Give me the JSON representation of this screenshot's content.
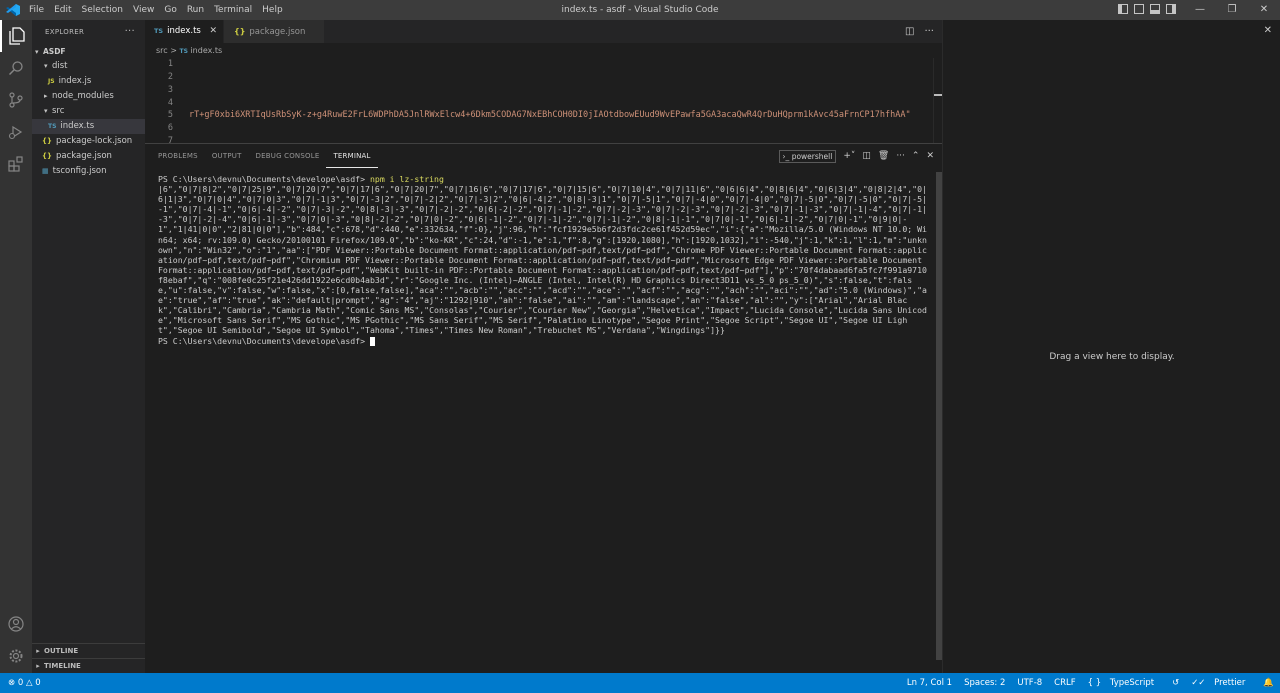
{
  "app": {
    "window_title": "index.ts - asdf - Visual Studio Code",
    "menu": [
      "File",
      "Edit",
      "Selection",
      "View",
      "Go",
      "Run",
      "Terminal",
      "Help"
    ]
  },
  "sidebar": {
    "header": "EXPLORER",
    "more": "···",
    "root": "ASDF",
    "tree": [
      {
        "label": "dist",
        "type": "folder-open"
      },
      {
        "label": "index.js",
        "type": "js"
      },
      {
        "label": "node_modules",
        "type": "folder-closed"
      },
      {
        "label": "src",
        "type": "folder-open"
      },
      {
        "label": "index.ts",
        "type": "ts"
      },
      {
        "label": "package-lock.json",
        "type": "json"
      },
      {
        "label": "package.json",
        "type": "json"
      },
      {
        "label": "tsconfig.json",
        "type": "tsconfig"
      }
    ],
    "outline": "OUTLINE",
    "timeline": "TIMELINE"
  },
  "editor": {
    "tabs": [
      {
        "label": "index.ts",
        "icon": "TS",
        "active": true
      },
      {
        "label": "package.json",
        "icon": "{}",
        "active": false
      }
    ],
    "breadcrumb": {
      "folder": "src",
      "sep": ">",
      "file_icon": "TS",
      "file": "index.ts"
    },
    "line_numbers": [
      "1",
      "2",
      "3",
      "4",
      "5",
      "6",
      "7"
    ],
    "line5": "rT+gF0xbi6XRTIqUsRbSyK-z+g4RuwE2FrL6WDPhDA5JnlRWxElcw4+6Dkm5CODAG7NxEBhCOH0DI0jIAOtdbowEUud9WvEPawfa5GA3acaQwR4QrDuHQprm1kAvc45aFrnCP17hfhAA\""
  },
  "panel": {
    "tabs": [
      "PROBLEMS",
      "OUTPUT",
      "DEBUG CONSOLE",
      "TERMINAL"
    ],
    "active_tab": "TERMINAL",
    "shell": "powershell",
    "terminal": {
      "prompt": "PS C:\\Users\\devnu\\Documents\\develope\\asdf> ",
      "command": "npm i lz-string",
      "output": "|6\",\"0|7|8|2\",\"0|7|25|9\",\"0|7|20|7\",\"0|7|17|6\",\"0|7|20|7\",\"0|7|16|6\",\"0|7|17|6\",\"0|7|15|6\",\"0|7|10|4\",\"0|7|11|6\",\"0|6|6|4\",\"0|8|6|4\",\"0|6|3|4\",\"0|8|2|4\",\"0|6|1|3\",\"0|7|0|4\",\"0|7|0|3\",\"0|7|-1|3\",\"0|7|-3|2\",\"0|7|-2|2\",\"0|7|-3|2\",\"0|6|-4|2\",\"0|8|-3|1\",\"0|7|-5|1\",\"0|7|-4|0\",\"0|7|-4|0\",\"0|7|-5|0\",\"0|7|-5|0\",\"0|7|-5|-1\",\"0|7|-4|-1\",\"0|6|-4|-2\",\"0|7|-3|-2\",\"0|8|-3|-3\",\"0|7|-2|-2\",\"0|6|-2|-2\",\"0|7|-1|-2\",\"0|7|-2|-3\",\"0|7|-2|-3\",\"0|7|-2|-3\",\"0|7|-1|-3\",\"0|7|-1|-4\",\"0|7|-1|-3\",\"0|7|-2|-4\",\"0|6|-1|-3\",\"0|7|0|-3\",\"0|8|-2|-2\",\"0|7|0|-2\",\"0|6|-1|-2\",\"0|7|-1|-2\",\"0|7|-1|-2\",\"0|8|-1|-1\",\"0|7|0|-1\",\"0|6|-1|-2\",\"0|7|0|-1\",\"0|9|0|-1\",\"1|41|0|0\",\"2|81|0|0\"],\"b\":484,\"c\":678,\"d\":440,\"e\":332634,\"f\":0},\"j\":96,\"h\":\"fcf1929e5b6f2d3fdc2ce61f452d59ec\",\"i\":{\"a\":\"Mozilla/5.0 (Windows NT 10.0; Win64; x64; rv:109.0) Gecko/20100101 Firefox/109.0\",\"b\":\"ko-KR\",\"c\":24,\"d\":-1,\"e\":1,\"f\":8,\"g\":[1920,1080],\"h\":[1920,1032],\"i\":-540,\"j\":1,\"k\":1,\"l\":1,\"m\":\"unknown\",\"n\":\"Win32\",\"o\":\"1\",\"aa\":[\"PDF Viewer::Portable Document Format::application/pdf~pdf,text/pdf~pdf\",\"Chrome PDF Viewer::Portable Document Format::application/pdf~pdf,text/pdf~pdf\",\"Chromium PDF Viewer::Portable Document Format::application/pdf~pdf,text/pdf~pdf\",\"Microsoft Edge PDF Viewer::Portable Document Format::application/pdf~pdf,text/pdf~pdf\",\"WebKit built-in PDF::Portable Document Format::application/pdf~pdf,text/pdf~pdf\"],\"p\":\"70f4dabaad6fa5fc7f991a9710f8ebaf\",\"q\":\"008fe0c25f21e426dd1922e6cd0b4ab3d\",\"r\":\"Google Inc. (Intel)~ANGLE (Intel, Intel(R) HD Graphics Direct3D11 vs_5_0 ps_5_0)\",\"s\":false,\"t\":false,\"u\":false,\"v\":false,\"w\":false,\"x\":[0,false,false],\"aca\":\"\",\"acb\":\"\",\"acc\":\"\",\"acd\":\"\",\"ace\":\"\",\"acf\":\"\",\"acg\":\"\",\"ach\":\"\",\"aci\":\"\",\"ad\":\"5.0 (Windows)\",\"ae\":\"true\",\"af\":\"true\",\"ak\":\"default|prompt\",\"ag\":\"4\",\"aj\":\"1292|910\",\"ah\":\"false\",\"ai\":\"\",\"am\":\"landscape\",\"an\":\"false\",\"al\":\"\",\"y\":[\"Arial\",\"Arial Black\",\"Calibri\",\"Cambria\",\"Cambria Math\",\"Comic Sans MS\",\"Consolas\",\"Courier\",\"Courier New\",\"Georgia\",\"Helvetica\",\"Impact\",\"Lucida Console\",\"Lucida Sans Unicode\",\"Microsoft Sans Serif\",\"MS Gothic\",\"MS PGothic\",\"MS Sans Serif\",\"MS Serif\",\"Palatino Linotype\",\"Segoe Print\",\"Segoe Script\",\"Segoe UI\",\"Segoe UI Light\",\"Segoe UI Semibold\",\"Segoe UI Symbol\",\"Tahoma\",\"Times\",\"Times New Roman\",\"Trebuchet MS\",\"Verdana\",\"Wingdings\"]}}",
      "final_prompt": "PS C:\\Users\\devnu\\Documents\\develope\\asdf> "
    }
  },
  "right_group": {
    "hint": "Drag a view here to display."
  },
  "statusbar": {
    "errors": "0",
    "warnings": "0",
    "position": "Ln 7, Col 1",
    "spaces": "Spaces: 2",
    "encoding": "UTF-8",
    "eol": "CRLF",
    "language": "TypeScript",
    "prettier": "Prettier"
  },
  "colors": {
    "accent": "#007acc",
    "ts_icon": "#519aba",
    "json_icon": "#cbcb41",
    "string": "#ce9178"
  }
}
